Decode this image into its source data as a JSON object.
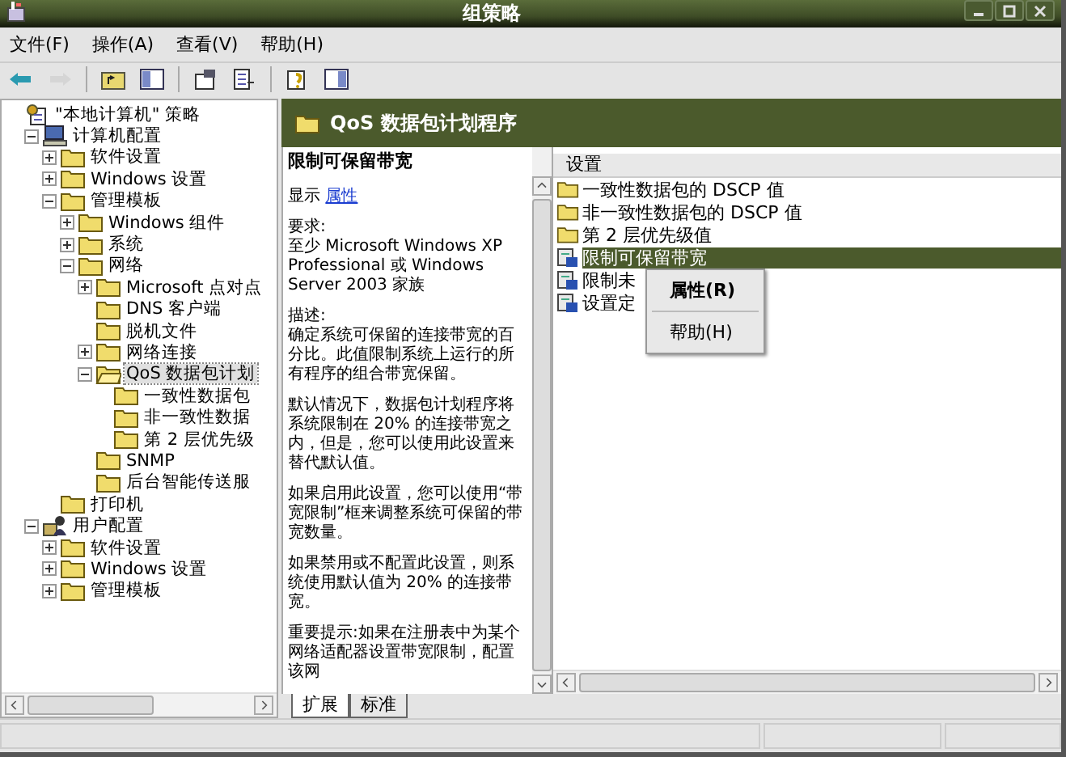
{
  "window": {
    "title": "组策略"
  },
  "menu": [
    {
      "label": "文件(F)"
    },
    {
      "label": "操作(A)"
    },
    {
      "label": "查看(V)"
    },
    {
      "label": "帮助(H)"
    }
  ],
  "toolbar": [
    {
      "kind": "back",
      "disabled": false
    },
    {
      "kind": "forward",
      "disabled": true
    },
    {
      "kind": "separator"
    },
    {
      "kind": "up",
      "disabled": false
    },
    {
      "kind": "tree",
      "disabled": false
    },
    {
      "kind": "separator"
    },
    {
      "kind": "properties",
      "disabled": false
    },
    {
      "kind": "export",
      "disabled": false
    },
    {
      "kind": "separator"
    },
    {
      "kind": "help",
      "disabled": false
    },
    {
      "kind": "panel",
      "disabled": false
    }
  ],
  "tree": [
    {
      "label": "\"本地计算机\" 策略",
      "kind": "policy",
      "selected": false,
      "children": [
        {
          "label": "计算机配置",
          "kind": "computer",
          "expanded": true,
          "selected": false,
          "children": [
            {
              "label": "软件设置",
              "kind": "folder",
              "expanded": false,
              "selected": false
            },
            {
              "label": "Windows 设置",
              "kind": "folder",
              "expanded": false,
              "selected": false
            },
            {
              "label": "管理模板",
              "kind": "folder",
              "expanded": true,
              "selected": false,
              "children": [
                {
                  "label": "Windows 组件",
                  "kind": "folder",
                  "expanded": false,
                  "selected": false
                },
                {
                  "label": "系统",
                  "kind": "folder",
                  "expanded": false,
                  "selected": false
                },
                {
                  "label": "网络",
                  "kind": "folder",
                  "expanded": true,
                  "selected": false,
                  "children": [
                    {
                      "label": "Microsoft 点对点",
                      "kind": "folder",
                      "expanded": false,
                      "selected": false
                    },
                    {
                      "label": "DNS 客户端",
                      "kind": "folder",
                      "selected": false
                    },
                    {
                      "label": "脱机文件",
                      "kind": "folder",
                      "selected": false
                    },
                    {
                      "label": "网络连接",
                      "kind": "folder",
                      "expanded": false,
                      "selected": false
                    },
                    {
                      "label": "QoS 数据包计划",
                      "kind": "folder-open",
                      "expanded": true,
                      "selected": true,
                      "children": [
                        {
                          "label": "一致性数据包",
                          "kind": "folder",
                          "selected": false
                        },
                        {
                          "label": "非一致性数据",
                          "kind": "folder",
                          "selected": false
                        },
                        {
                          "label": "第 2 层优先级",
                          "kind": "folder",
                          "selected": false
                        }
                      ]
                    },
                    {
                      "label": "SNMP",
                      "kind": "folder",
                      "selected": false
                    },
                    {
                      "label": "后台智能传送服",
                      "kind": "folder",
                      "selected": false
                    }
                  ]
                }
              ]
            },
            {
              "label": "打印机",
              "kind": "folder",
              "selected": false
            }
          ]
        },
        {
          "label": "用户配置",
          "kind": "user",
          "expanded": true,
          "selected": false,
          "children": [
            {
              "label": "软件设置",
              "kind": "folder",
              "expanded": false,
              "selected": false
            },
            {
              "label": "Windows 设置",
              "kind": "folder",
              "expanded": false,
              "selected": false
            },
            {
              "label": "管理模板",
              "kind": "folder",
              "expanded": false,
              "selected": false
            }
          ]
        }
      ]
    }
  ],
  "header": {
    "title": "QoS 数据包计划程序"
  },
  "description": {
    "title": "限制可保留带宽",
    "show_label": "显示",
    "link": "属性",
    "paragraphs": [
      "要求:\n至少 Microsoft Windows XP Professional 或 Windows Server 2003 家族",
      "描述:\n确定系统可保留的连接带宽的百分比。此值限制系统上运行的所有程序的组合带宽保留。",
      "默认情况下，数据包计划程序将系统限制在 20% 的连接带宽之内，但是，您可以使用此设置来替代默认值。",
      "如果启用此设置，您可以使用“带宽限制”框来调整系统可保留的带宽数量。",
      "如果禁用或不配置此设置，则系统使用默认值为 20% 的连接带宽。",
      "重要提示:如果在注册表中为某个网络适配器设置带宽限制，配置该网"
    ]
  },
  "list": {
    "column": "设置",
    "items": [
      {
        "kind": "folder",
        "label": "一致性数据包的 DSCP 值",
        "selected": false
      },
      {
        "kind": "folder",
        "label": "非一致性数据包的 DSCP 值",
        "selected": false
      },
      {
        "kind": "folder",
        "label": "第 2 层优先级值",
        "selected": false
      },
      {
        "kind": "setting",
        "label": "限制可保留带宽",
        "selected": true
      },
      {
        "kind": "setting",
        "label": "限制未",
        "selected": false
      },
      {
        "kind": "setting",
        "label": "设置定",
        "selected": false
      }
    ]
  },
  "context_menu": [
    {
      "kind": "item",
      "label": "属性(R)",
      "default": true
    },
    {
      "kind": "separator"
    },
    {
      "kind": "item",
      "label": "帮助(H)",
      "default": false
    }
  ],
  "tabs": [
    {
      "label": "扩展",
      "selected": true
    },
    {
      "label": "标准",
      "selected": false
    }
  ]
}
